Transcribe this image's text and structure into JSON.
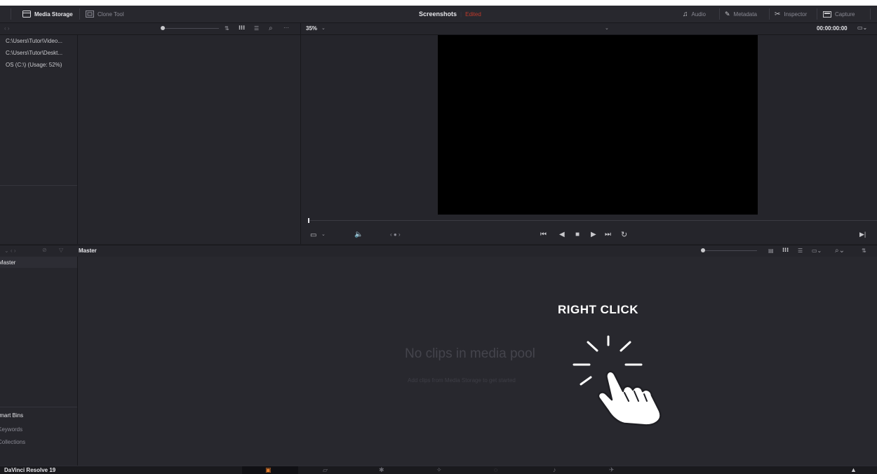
{
  "topbar": {
    "media_storage": "Media Storage",
    "clone_tool": "Clone Tool",
    "project_title": "Screenshots",
    "project_status": "Edited",
    "audio": "Audio",
    "metadata": "Metadata",
    "inspector": "Inspector",
    "capture": "Capture"
  },
  "viewer": {
    "zoom": "35%",
    "timecode": "00:00:00:00"
  },
  "storage_locations": [
    "C:\\Users\\Tutor\\Video...",
    "C:\\Users\\Tutor\\Deskt...",
    "OS (C:\\) (Usage: 52%)"
  ],
  "media_pool": {
    "tab_label": "Master",
    "bin_master": "Master",
    "empty_title": "No clips in media pool",
    "empty_subtitle": "Add clips from Media Storage to get started"
  },
  "smart_bins": {
    "header": "Smart Bins",
    "keywords": "Keywords",
    "collections": "Collections"
  },
  "annotation": {
    "label": "RIGHT CLICK"
  },
  "footer": {
    "app_name": "DaVinci Resolve 19"
  },
  "colors": {
    "background": "#1f1f24",
    "panel": "#26262c",
    "accent_red": "#c0392b",
    "annotation_white": "#ffffff"
  }
}
